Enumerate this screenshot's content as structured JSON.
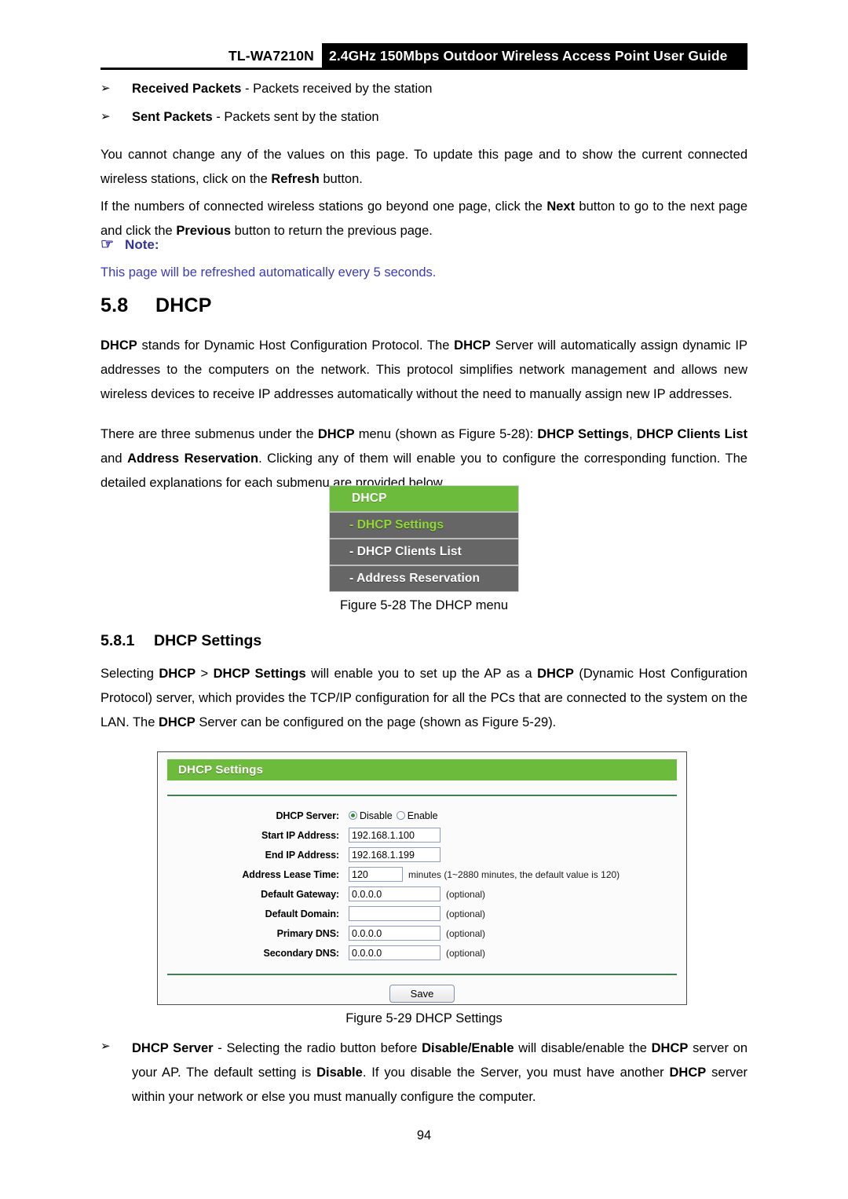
{
  "header": {
    "model": "TL-WA7210N",
    "title": "2.4GHz 150Mbps Outdoor Wireless Access Point User Guide"
  },
  "bullets_top": [
    {
      "marker": "➢",
      "bold": "Received Packets",
      "rest": " - Packets received by the station"
    },
    {
      "marker": "➢",
      "bold": "Sent Packets",
      "rest": " - Packets sent by the station"
    }
  ],
  "paragraphs": {
    "refresh": "You cannot change any of the values on this page. To update this page and to show the current connected wireless stations, click on the Refresh button.",
    "pagination": "If the numbers of connected wireless stations go beyond one page, click the Next button to go to the next page and click the Previous button to return the previous page.",
    "dhcp_intro": "DHCP stands for Dynamic Host Configuration Protocol. The DHCP Server will automatically assign dynamic IP addresses to the computers on the network. This protocol simplifies network management and allows new wireless devices to receive IP addresses automatically without the need to manually assign new IP addresses.",
    "submenus": "There are three submenus under the DHCP menu (shown as Figure 5-28): DHCP Settings, DHCP Clients List and Address Reservation. Clicking any of them will enable you to configure the corresponding function. The detailed explanations for each submenu are provided below.",
    "settings_intro": "Selecting DHCP > DHCP Settings will enable you to set up the AP as a DHCP (Dynamic Host Configuration Protocol) server, which provides the TCP/IP configuration for all the PCs that are connected to the system on the LAN. The DHCP Server can be configured on the page (shown as Figure 5-29)."
  },
  "note": {
    "icon": "pointing-hand-icon",
    "icon_glyph": "☞",
    "label": "Note:",
    "text": "This page will be refreshed automatically every 5 seconds.",
    "head_color": "#333399",
    "body_color": "#3b3bb5"
  },
  "section_58": {
    "number": "5.8",
    "title": "DHCP"
  },
  "section_581": {
    "number": "5.8.1",
    "title": "DHCP Settings"
  },
  "dhcp_menu": {
    "header": "DHCP",
    "items": [
      {
        "dash": "-",
        "label": "DHCP Settings",
        "active": true
      },
      {
        "dash": "-",
        "label": "DHCP Clients List",
        "active": false
      },
      {
        "dash": "-",
        "label": "Address Reservation",
        "active": false
      }
    ],
    "colors": {
      "header_bg": "#6cbb3c",
      "item_bg": "#666666",
      "active_text": "#8fdc2e",
      "item_text": "#ffffff"
    }
  },
  "figure_28_caption": "Figure 5-28 The DHCP menu",
  "dhcp_settings_panel": {
    "title": "DHCP Settings",
    "rows": [
      {
        "label": "DHCP Server:",
        "type": "radio",
        "options": [
          "Disable",
          "Enable"
        ],
        "selected": "Disable"
      },
      {
        "label": "Start IP Address:",
        "type": "text",
        "value": "192.168.1.100",
        "hint": ""
      },
      {
        "label": "End IP Address:",
        "type": "text",
        "value": "192.168.1.199",
        "hint": ""
      },
      {
        "label": "Address Lease Time:",
        "type": "small",
        "value": "120",
        "hint": "minutes (1~2880 minutes, the default value is 120)"
      },
      {
        "label": "Default Gateway:",
        "type": "opt",
        "value": "0.0.0.0",
        "hint": "(optional)"
      },
      {
        "label": "Default Domain:",
        "type": "opt",
        "value": "",
        "hint": "(optional)"
      },
      {
        "label": "Primary DNS:",
        "type": "opt",
        "value": "0.0.0.0",
        "hint": "(optional)"
      },
      {
        "label": "Secondary DNS:",
        "type": "opt",
        "value": "0.0.0.0",
        "hint": "(optional)"
      }
    ],
    "save_label": "Save"
  },
  "figure_29_caption": "Figure 5-29 DHCP Settings",
  "bullet_bottom": {
    "marker": "➢",
    "bold": "DHCP Server",
    "rest": " - Selecting the radio button before Disable/Enable will disable/enable the DHCP server on your AP. The default setting is Disable. If you disable the Server, you must have another DHCP server within your network or else you must manually configure the computer."
  },
  "page_number": "94"
}
